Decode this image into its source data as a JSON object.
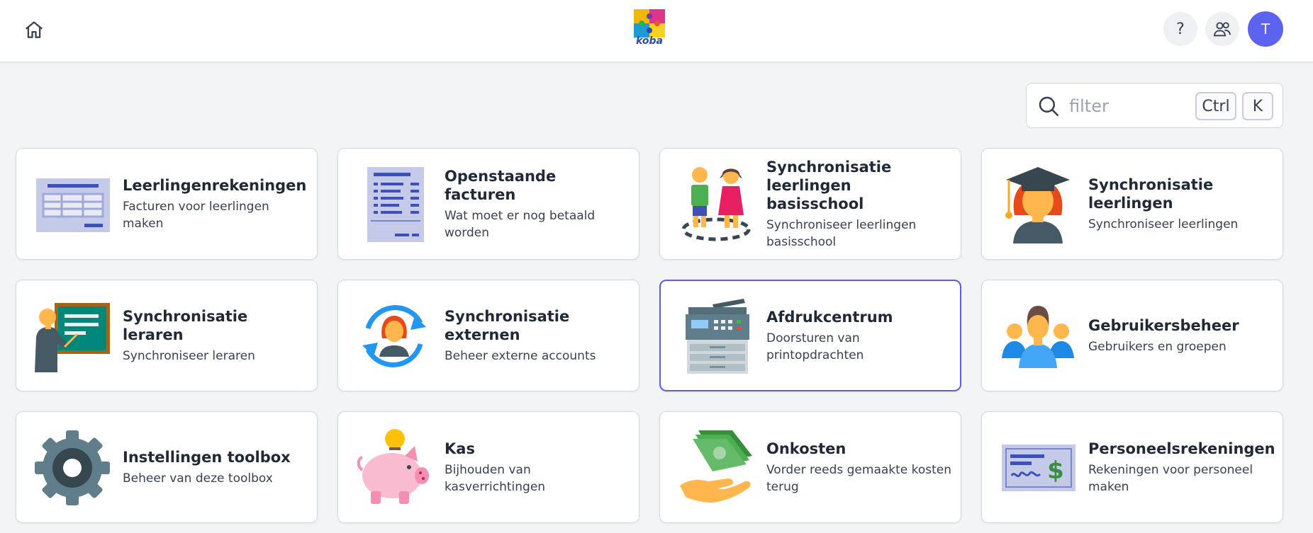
{
  "header": {
    "logo_text": "koba",
    "help_label": "?",
    "avatar_initial": "T"
  },
  "filter": {
    "placeholder": "filter",
    "kbd_ctrl": "Ctrl",
    "kbd_k": "K"
  },
  "tiles": [
    {
      "title": "Leerlingenrekeningen",
      "desc": "Facturen voor leerlingen maken",
      "icon": "spreadsheet-icon"
    },
    {
      "title": "Openstaande facturen",
      "desc": "Wat moet er nog betaald worden",
      "icon": "invoice-icon"
    },
    {
      "title": "Synchronisatie leerlingen basisschool",
      "desc": "Synchroniseer leerlingen basisschool",
      "icon": "children-icon"
    },
    {
      "title": "Synchronisatie leerlingen",
      "desc": "Synchroniseer leerlingen",
      "icon": "graduate-icon"
    },
    {
      "title": "Synchronisatie leraren",
      "desc": "Synchroniseer leraren",
      "icon": "teacher-icon"
    },
    {
      "title": "Synchronisatie externen",
      "desc": "Beheer externe accounts",
      "icon": "sync-user-icon"
    },
    {
      "title": "Afdrukcentrum",
      "desc": "Doorsturen van printopdrachten",
      "icon": "printer-icon"
    },
    {
      "title": "Gebruikersbeheer",
      "desc": "Gebruikers en groepen",
      "icon": "user-group-icon"
    },
    {
      "title": "Instellingen toolbox",
      "desc": "Beheer van deze toolbox",
      "icon": "gear-icon"
    },
    {
      "title": "Kas",
      "desc": "Bijhouden van kasverrichtingen",
      "icon": "piggy-bank-icon"
    },
    {
      "title": "Onkosten",
      "desc": "Vorder reeds gemaakte kosten terug",
      "icon": "money-hand-icon"
    },
    {
      "title": "Personeelsrekeningen",
      "desc": "Rekeningen voor personeel maken",
      "icon": "cheque-icon"
    }
  ],
  "colors": {
    "accent": "#5b63f0",
    "selected_border": "#5a5fe0",
    "background": "#f3f4f6"
  }
}
